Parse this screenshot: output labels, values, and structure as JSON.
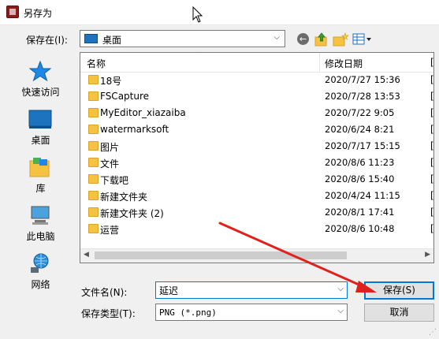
{
  "window": {
    "title": "另存为"
  },
  "toolbar": {
    "save_in_label": "保存在(I):",
    "save_in_value": "桌面"
  },
  "places": [
    {
      "label": "快速访问",
      "icon": "star-icon"
    },
    {
      "label": "桌面",
      "icon": "desktop-icon"
    },
    {
      "label": "库",
      "icon": "library-icon"
    },
    {
      "label": "此电脑",
      "icon": "computer-icon"
    },
    {
      "label": "网络",
      "icon": "network-icon"
    }
  ],
  "file_list": {
    "columns": {
      "name": "名称",
      "modified": "修改日期",
      "next_col_fragment": "["
    },
    "rows": [
      {
        "name": "18号",
        "date": "2020/7/27 15:36"
      },
      {
        "name": "FSCapture",
        "date": "2020/7/28 13:53"
      },
      {
        "name": "MyEditor_xiazaiba",
        "date": "2020/7/22 9:05"
      },
      {
        "name": "watermarksoft",
        "date": "2020/6/24 8:21"
      },
      {
        "name": "图片",
        "date": "2020/7/17 15:15"
      },
      {
        "name": "文件",
        "date": "2020/8/6 11:23"
      },
      {
        "name": "下载吧",
        "date": "2020/8/6 15:40"
      },
      {
        "name": "新建文件夹",
        "date": "2020/4/24 11:15"
      },
      {
        "name": "新建文件夹 (2)",
        "date": "2020/8/1 17:41"
      },
      {
        "name": "运营",
        "date": "2020/8/6 10:48"
      }
    ]
  },
  "form": {
    "filename_label": "文件名(N):",
    "filename_value": "延迟",
    "filetype_label": "保存类型(T):",
    "filetype_value": "PNG (*.png)",
    "save_button": "保存(S)",
    "cancel_button": "取消"
  },
  "colors": {
    "accent": "#0078d7",
    "folder": "#f5c242",
    "annotation_arrow": "#e0201c"
  }
}
